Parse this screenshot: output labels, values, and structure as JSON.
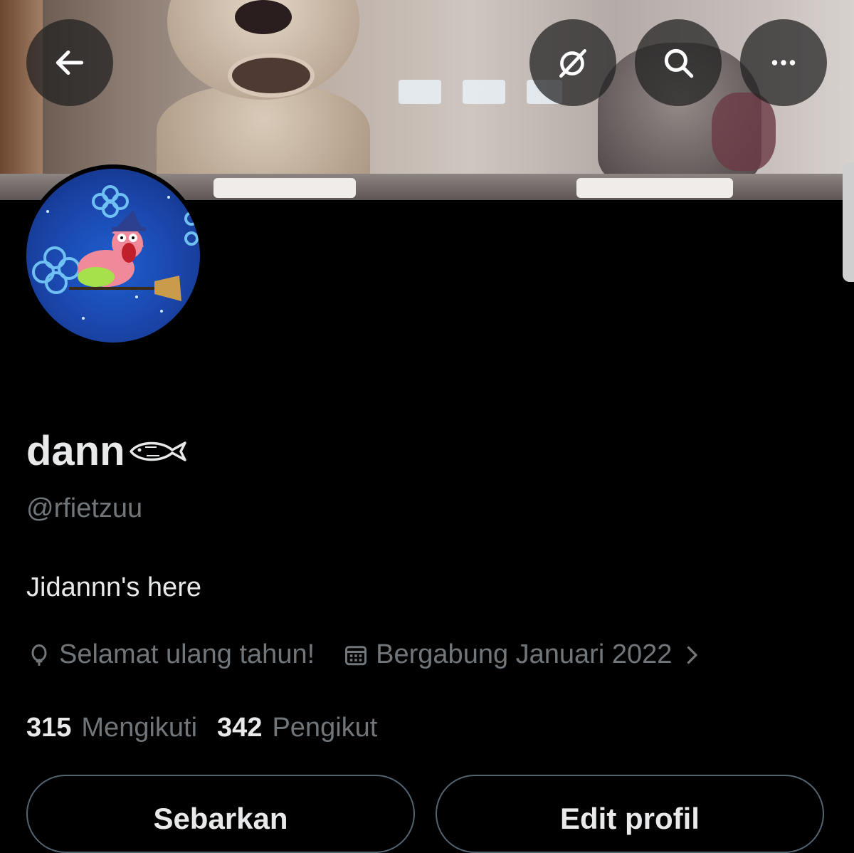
{
  "header": {
    "back_icon": "arrow-left-icon",
    "grok_icon": "grok-icon",
    "search_icon": "search-icon",
    "more_icon": "more-horizontal-icon"
  },
  "profile": {
    "display_name": "dann",
    "handle": "@rfietzuu",
    "bio": "Jidannn's here",
    "birthday_text": "Selamat ulang tahun!",
    "joined_text": "Bergabung Januari 2022",
    "following_count": "315",
    "following_label": "Mengikuti",
    "followers_count": "342",
    "followers_label": "Pengikut"
  },
  "actions": {
    "share_label": "Sebarkan",
    "edit_label": "Edit profil"
  },
  "colors": {
    "background": "#000000",
    "text_primary": "#e7e9ea",
    "text_secondary": "#71767b",
    "button_border": "#536471"
  }
}
